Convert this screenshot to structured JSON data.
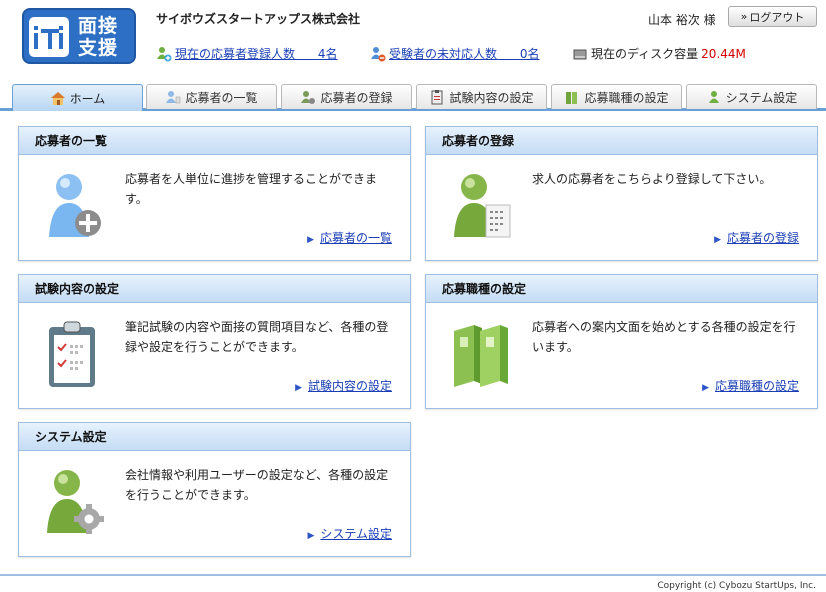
{
  "header": {
    "logo_text_line1": "面接",
    "logo_text_line2": "支援",
    "company": "サイボウズスタートアップス株式会社",
    "user": "山本 裕次 様",
    "logout_label": "ログアウト",
    "stats": [
      {
        "label": "現在の応募者登録人数",
        "value": "4名"
      },
      {
        "label": "受験者の未対応人数",
        "value": "0名"
      }
    ],
    "disk": {
      "label": "現在のディスク容量",
      "value": "20.44M"
    }
  },
  "tabs": [
    {
      "label": "ホーム",
      "icon": "house-icon",
      "active": true
    },
    {
      "label": "応募者の一覧",
      "icon": "person-list-icon"
    },
    {
      "label": "応募者の登録",
      "icon": "person-add-icon"
    },
    {
      "label": "試験内容の設定",
      "icon": "clipboard-icon"
    },
    {
      "label": "応募職種の設定",
      "icon": "binder-icon"
    },
    {
      "label": "システム設定",
      "icon": "person-gear-icon"
    }
  ],
  "panels": [
    {
      "title": "応募者の一覧",
      "desc": "応募者を人単位に進捗を管理することができます。",
      "link": "応募者の一覧",
      "icon": "person-plus-icon"
    },
    {
      "title": "応募者の登録",
      "desc": "求人の応募者をこちらより登録して下さい。",
      "link": "応募者の登録",
      "icon": "person-form-icon"
    },
    {
      "title": "試験内容の設定",
      "desc": "筆記試験の内容や面接の質問項目など、各種の登録や設定を行うことができます。",
      "link": "試験内容の設定",
      "icon": "clipboard-check-icon"
    },
    {
      "title": "応募職種の設定",
      "desc": "応募者への案内文面を始めとする各種の設定を行います。",
      "link": "応募職種の設定",
      "icon": "binders-icon"
    },
    {
      "title": "システム設定",
      "desc": "会社情報や利用ユーザーの設定など、各種の設定を行うことができます。",
      "link": "システム設定",
      "icon": "person-gear-icon"
    }
  ],
  "footer": {
    "copyright": "Copyright (c) Cybozu StartUps, Inc."
  },
  "colors": {
    "accent": "#6a9fd6",
    "logo": "#2d6fc4",
    "link": "#1a3fb5",
    "disk_value": "#d40000"
  }
}
